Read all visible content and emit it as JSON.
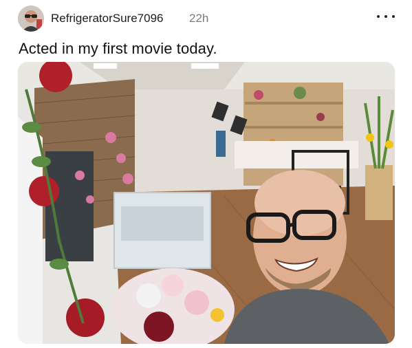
{
  "post": {
    "username": "RefrigeratorSure7096",
    "time_ago": "22h",
    "title": "Acted in my first movie today.",
    "more_icon": "more-horizontal-icon"
  },
  "colors": {
    "username": "#1c1c1c",
    "time": "#7a7a7a",
    "title": "#111111"
  }
}
